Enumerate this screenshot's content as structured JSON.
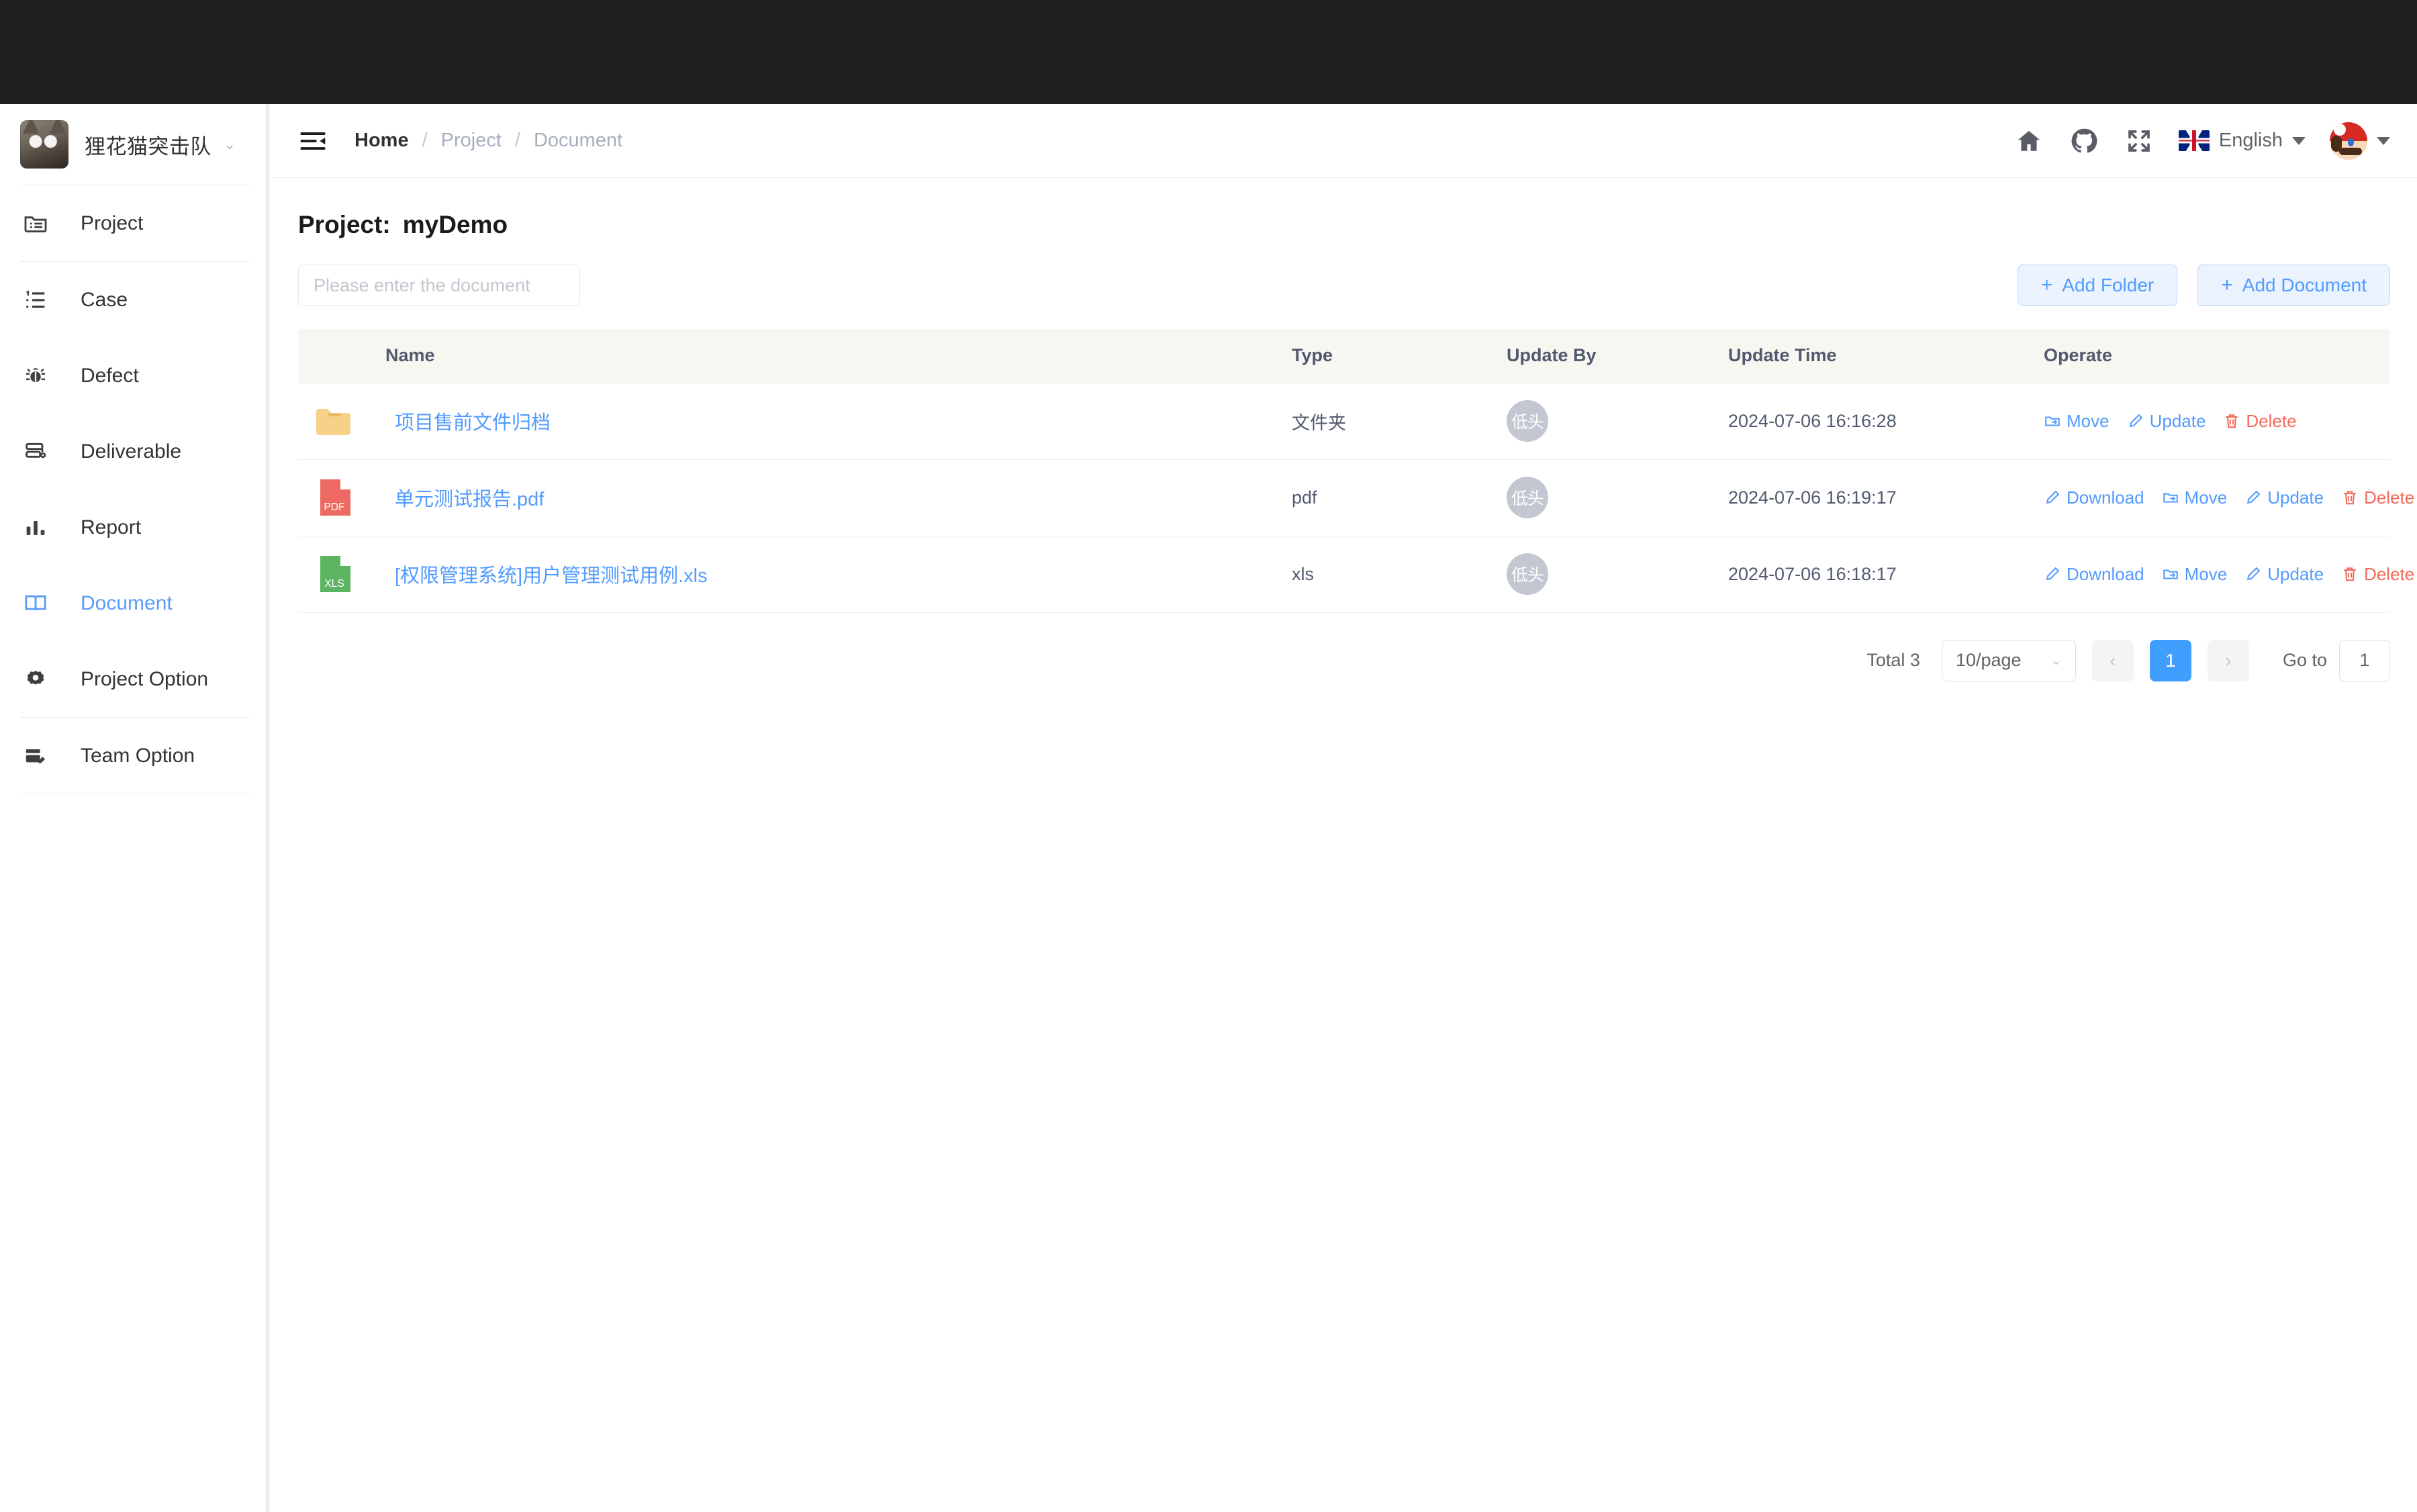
{
  "sidebar": {
    "brand": {
      "name": "狸花猫突击队",
      "avatar": "cat-avatar",
      "caret": "⌄"
    },
    "items": [
      {
        "label": "Project",
        "icon": "folder-list-icon",
        "active": false
      },
      {
        "label": "Case",
        "icon": "ordered-list-icon",
        "active": false
      },
      {
        "label": "Defect",
        "icon": "bug-icon",
        "active": false
      },
      {
        "label": "Deliverable",
        "icon": "deliverable-icon",
        "active": false
      },
      {
        "label": "Report",
        "icon": "bar-chart-icon",
        "active": false
      },
      {
        "label": "Document",
        "icon": "book-icon",
        "active": true
      },
      {
        "label": "Project Option",
        "icon": "gear-icon",
        "active": false
      },
      {
        "label": "Team Option",
        "icon": "team-edit-icon",
        "active": false
      }
    ]
  },
  "header": {
    "hamburger": "menu-fold-icon",
    "breadcrumb": {
      "home": "Home",
      "sep": "/",
      "project": "Project",
      "current": "Document"
    },
    "icons": [
      "home-icon",
      "github-icon",
      "fullscreen-icon"
    ],
    "language": {
      "label": "English",
      "flag": "uk-flag-icon"
    },
    "user": "mario-avatar"
  },
  "main": {
    "title_label": "Project:",
    "title_value": "myDemo",
    "search": {
      "value": "",
      "placeholder": "Please enter the document"
    },
    "buttons": {
      "add_folder": "Add Folder",
      "add_document": "Add Document",
      "plus": "+"
    },
    "table": {
      "columns": [
        "Name",
        "Type",
        "Update By",
        "Update Time",
        "Operate"
      ],
      "rows": [
        {
          "name": "项目售前文件归档",
          "icon": "folder-icon",
          "type": "文件夹",
          "update_by": "低头",
          "update_time": "2024-07-06 16:16:28",
          "ops": [
            "Move",
            "Update",
            "Delete"
          ]
        },
        {
          "name": "单元测试报告.pdf",
          "icon": "pdf-file-icon",
          "icon_label": "PDF",
          "type": "pdf",
          "update_by": "低头",
          "update_time": "2024-07-06 16:19:17",
          "ops": [
            "Download",
            "Move",
            "Update",
            "Delete"
          ]
        },
        {
          "name": "[权限管理系统]用户管理测试用例.xls",
          "icon": "xls-file-icon",
          "icon_label": "XLS",
          "type": "xls",
          "update_by": "低头",
          "update_time": "2024-07-06 16:18:17",
          "ops": [
            "Download",
            "Move",
            "Update",
            "Delete"
          ]
        }
      ]
    },
    "pagination": {
      "total": "Total 3",
      "page_size": "10/page",
      "prev": "‹",
      "next": "›",
      "current_page": "1",
      "goto_label": "Go to",
      "goto_value": "1"
    }
  },
  "colors": {
    "accent": "#409eff",
    "link": "#529bff",
    "danger": "#f36a5a",
    "folder": "#f7d08a",
    "pdf": "#ec6a62",
    "xls": "#5cb461",
    "topbar": "#1e1e1e",
    "table_head_bg": "#f7f7f2"
  }
}
